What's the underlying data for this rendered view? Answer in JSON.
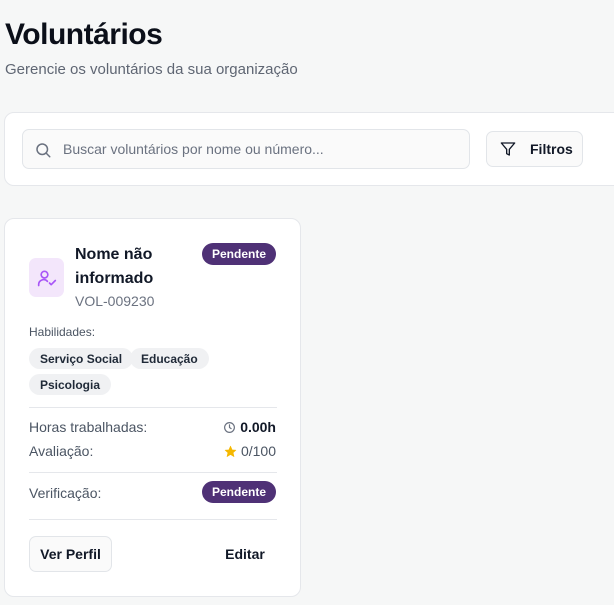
{
  "header": {
    "title": "Voluntários",
    "subtitle": "Gerencie os voluntários da sua organização"
  },
  "search": {
    "placeholder": "Buscar voluntários por nome ou número...",
    "icon": "search-icon"
  },
  "filters": {
    "label": "Filtros",
    "icon": "filter-icon"
  },
  "volunteer": {
    "name": "Nome não informado",
    "id": "VOL-009230",
    "status": "Pendente",
    "skills_label": "Habilidades:",
    "skills": [
      "Serviço Social",
      "Educação",
      "Psicologia"
    ],
    "hours_label": "Horas trabalhadas:",
    "hours_value": "0.00h",
    "rating_label": "Avaliação:",
    "rating_value": "0/100",
    "verification_label": "Verificação:",
    "verification_status": "Pendente",
    "view_profile_label": "Ver Perfil",
    "edit_label": "Editar",
    "avatar_icon": "user-check-icon"
  },
  "colors": {
    "badge_bg": "#4f3176",
    "avatar_bg": "#f3e6fb",
    "avatar_icon": "#a855f7",
    "star": "#f5b800"
  }
}
